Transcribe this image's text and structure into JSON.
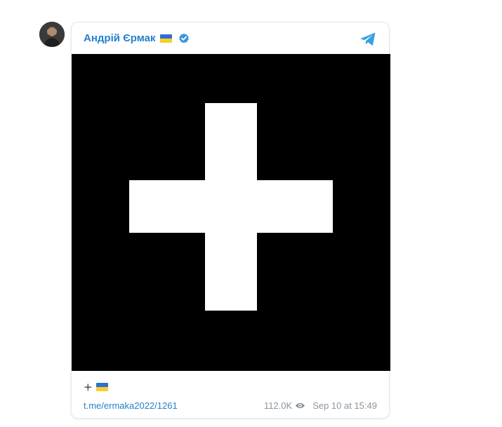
{
  "post": {
    "author": "Андрій Єрмак",
    "author_flag": "ukraine-flag",
    "verified_icon": "verified-badge-icon",
    "share_icon": "telegram-icon",
    "text_glyph": "+",
    "text_flag": "ukraine-flag",
    "link": "t.me/ermaka2022/1261",
    "views": "112.0K",
    "date": "Sep 10 at 15:49"
  },
  "colors": {
    "accent": "#2481cc",
    "meta": "#8a94a0",
    "photo_bg": "#000000",
    "flag_blue": "#2f6ed6",
    "flag_yellow": "#f5cf2c"
  }
}
